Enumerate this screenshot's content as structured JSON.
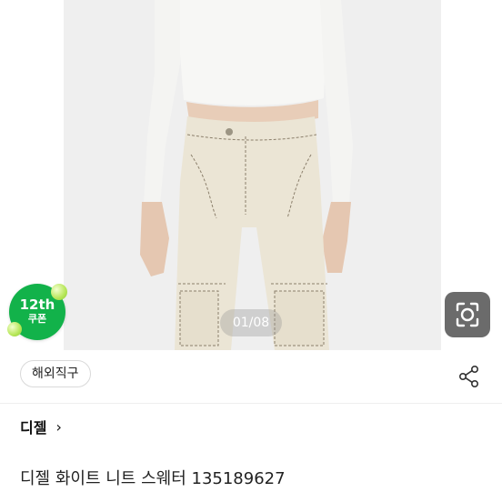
{
  "gallery": {
    "counter": "01/08"
  },
  "coupon": {
    "line1": "12th",
    "line2": "쿠폰",
    "color": "#12b24a"
  },
  "tags": {
    "overseas_label": "해외직구"
  },
  "store": {
    "name": "디젤",
    "chevron": "›"
  },
  "product": {
    "title": "디젤 화이트 니트 스웨터 135189627"
  },
  "icons": {
    "lens": "lens-search-icon",
    "share": "share-icon"
  }
}
